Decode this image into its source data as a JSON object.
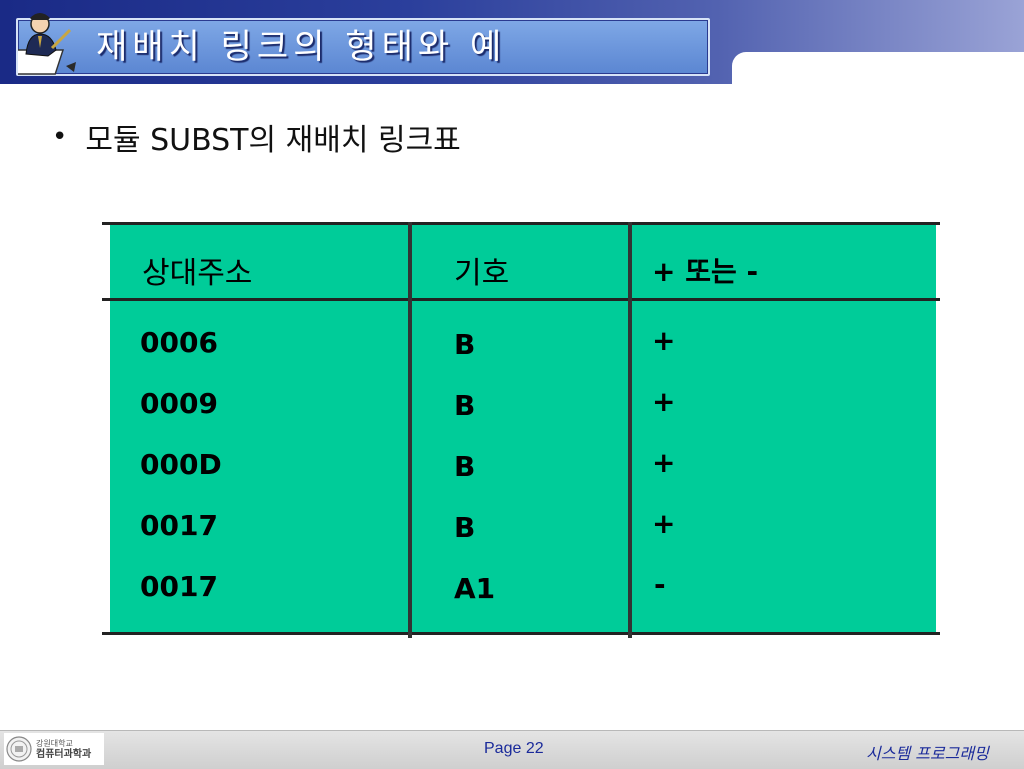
{
  "slide": {
    "title": "재배치 링크의 형태와 예",
    "bullet": "모듈 SUBST의 재배치 링크표",
    "bullet_marker": "•"
  },
  "table": {
    "headers": [
      "상대주소",
      "기호",
      "+ 또는 -"
    ],
    "rows": [
      [
        "0006",
        "B",
        "+"
      ],
      [
        "0009",
        "B",
        "+"
      ],
      [
        "000D",
        "B",
        "+"
      ],
      [
        "0017",
        "B",
        "+"
      ],
      [
        "0017",
        "A1",
        "-"
      ]
    ],
    "background_color": "#00cc99"
  },
  "footer": {
    "logo_line1": "강원대학교",
    "logo_line2": "컴퓨터과학과",
    "page": "Page 22",
    "course": "시스템  프로그래밍"
  },
  "colors": {
    "header_dark": "#1a2a86",
    "title_box": "#6e98dc",
    "footer_text": "#1a2a9a"
  },
  "icons": {
    "title_icon": "person-writing-icon",
    "footer_icon": "university-seal-icon"
  }
}
